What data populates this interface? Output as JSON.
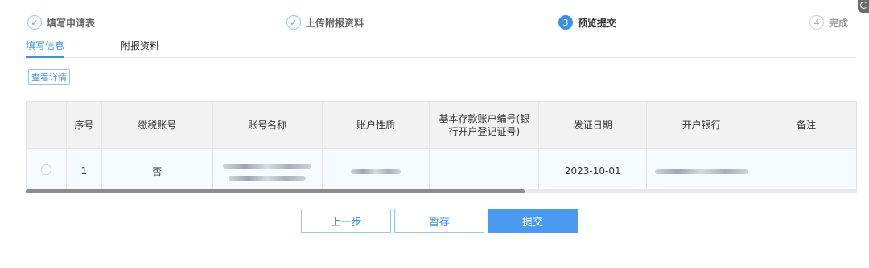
{
  "steps": [
    {
      "label": "填写申请表",
      "icon": "check-icon",
      "state": "done"
    },
    {
      "label": "上传附报资料",
      "icon": "check-icon",
      "state": "done"
    },
    {
      "label": "预览提交",
      "number": "3",
      "state": "active"
    },
    {
      "label": "完成",
      "number": "4",
      "state": "todo"
    }
  ],
  "tabs": [
    {
      "label": "填写信息",
      "active": true
    },
    {
      "label": "附报资料",
      "active": false
    }
  ],
  "detail_button": "查看详情",
  "table": {
    "columns": [
      "",
      "序号",
      "缴税账号",
      "账号名称",
      "账户性质",
      "基本存款账户编号(银行开户登记证号)",
      "发证日期",
      "开户银行",
      "备注"
    ],
    "rows": [
      {
        "index": "1",
        "tax_account": "否",
        "account_name": "",
        "account_nature": "",
        "basic_account_no": "",
        "issue_date": "2023-10-01",
        "bank": "",
        "remark": ""
      }
    ]
  },
  "footer": {
    "prev": "上一步",
    "save": "暂存",
    "submit": "提交"
  },
  "colors": {
    "accent": "#3d8fe8",
    "primary_button": "#4a9af0",
    "header_bg": "#f2f2f2"
  }
}
